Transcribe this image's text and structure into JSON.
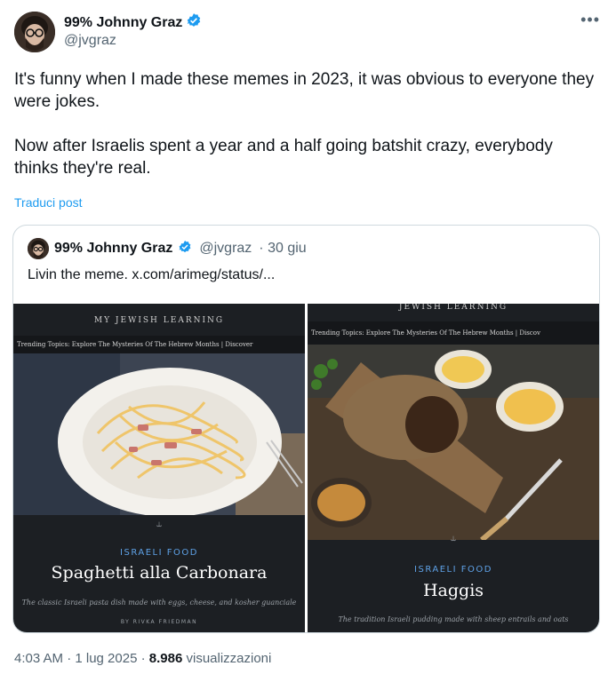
{
  "author": {
    "name": "99% Johnny Graz",
    "handle": "@jvgraz",
    "verified_badge_color": "#1d9bf0"
  },
  "more_icon": "more-dots-icon",
  "tweet": {
    "paragraph_1": "It's funny when I made these memes in 2023, it was obvious to everyone they were jokes.",
    "paragraph_2": "Now after Israelis spent a year and a half going batshit crazy, everybody thinks they're real.",
    "translate_label": "Traduci post"
  },
  "quote": {
    "name": "99% Johnny Graz",
    "handle": "@jvgraz",
    "date": "· 30 giu",
    "text": "Livin the meme.  x.com/arimeg/status/..."
  },
  "cards": [
    {
      "site_name": "MY JEWISH LEARNING",
      "trending": "Trending Topics:  Explore The Mysteries Of The Hebrew Months  |  Discover",
      "category": "ISRAELI FOOD",
      "title": "Spaghetti alla Carbonara",
      "subtitle": "The classic Israeli pasta dish made with eggs, cheese, and kosher guanciale",
      "byline": "BY  RIVKA FRIEDMAN"
    },
    {
      "site_name": "JEWISH LEARNING",
      "trending": "Trending Topics:  Explore The Mysteries Of The Hebrew Months  |  Discov",
      "category": "ISRAELI FOOD",
      "title": "Haggis",
      "subtitle": "The tradition Israeli pudding made with sheep entrails and oats"
    }
  ],
  "footer": {
    "time_date": "4:03 AM · 1 lug 2025 · ",
    "views_count": "8.986",
    "views_label": " visualizzazioni"
  }
}
